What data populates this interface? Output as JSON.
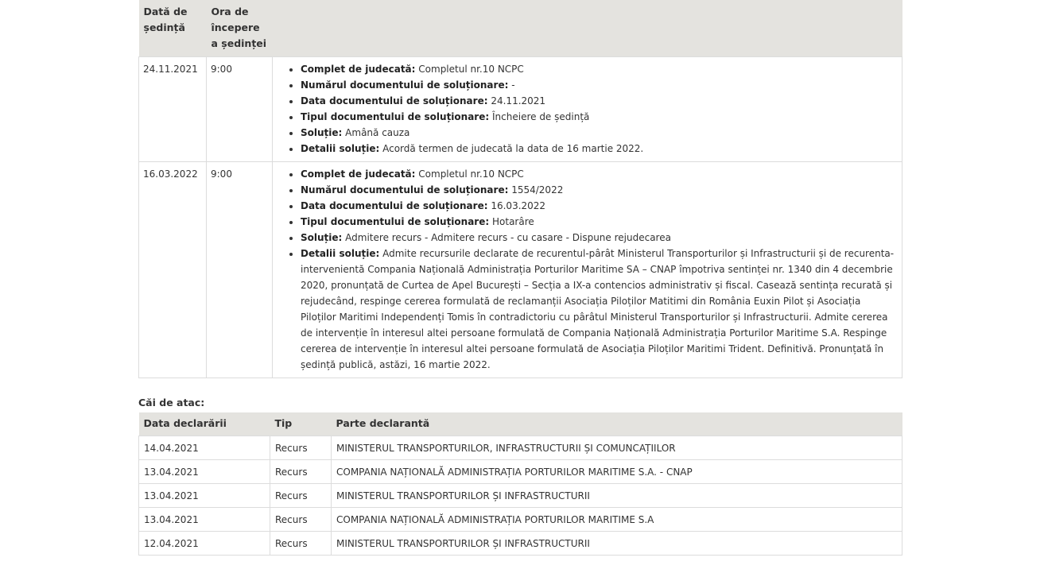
{
  "sessions": {
    "headers": {
      "date": "Dată de ședință",
      "time": "Ora de începere a ședinței",
      "details": ""
    },
    "rows": [
      {
        "date": "24.11.2021",
        "time": "9:00",
        "items": [
          {
            "label": "Complet de judecată:",
            "value": "Completul nr.10 NCPC"
          },
          {
            "label": "Numărul documentului de soluționare:",
            "value": "-"
          },
          {
            "label": "Data documentului de soluționare:",
            "value": "24.11.2021"
          },
          {
            "label": "Tipul documentului de soluționare:",
            "value": "Încheiere de ședință"
          },
          {
            "label": "Soluție:",
            "value": "Amână cauza"
          },
          {
            "label": "Detalii soluție:",
            "value": "Acordă termen de judecată la data de 16 martie 2022."
          }
        ]
      },
      {
        "date": "16.03.2022",
        "time": "9:00",
        "items": [
          {
            "label": "Complet de judecată:",
            "value": "Completul nr.10 NCPC"
          },
          {
            "label": "Numărul documentului de soluționare:",
            "value": "1554/2022"
          },
          {
            "label": "Data documentului de soluționare:",
            "value": "16.03.2022"
          },
          {
            "label": "Tipul documentului de soluționare:",
            "value": "Hotarâre"
          },
          {
            "label": "Soluție:",
            "value": "Admitere recurs - Admitere recurs - cu casare - Dispune rejudecarea"
          },
          {
            "label": "Detalii soluție:",
            "value": "Admite recursurile declarate de recurentul-pârât Ministerul Transporturilor și Infrastructurii și de recurenta-intervenientă Compania Națională Administrația Porturilor Maritime SA – CNAP împotriva sentinței nr. 1340 din 4 decembrie 2020, pronunțată de Curtea de Apel București – Secția a IX-a contencios administrativ și fiscal. Casează sentința recurată și rejudecând, respinge cererea formulată de reclamanții Asociația Piloților Matitimi din România Euxin Pilot și Asociația Piloților Maritimi Independenți Tomis în contradictoriu cu pârâtul Ministerul Transporturilor și Infrastructurii. Admite cererea de intervenție în interesul altei persoane formulată de Compania Națională Administrația Porturilor Maritime S.A. Respinge cererea de intervenție în interesul altei persoane formulată de Asociația Piloților Maritimi Trident. Definitivă. Pronunțată în ședință publică, astăzi, 16 martie 2022."
          }
        ]
      }
    ]
  },
  "cai_de_atac": {
    "title": "Căi de atac:",
    "headers": {
      "date": "Data declarării",
      "type": "Tip",
      "party": "Parte declarantă"
    },
    "rows": [
      {
        "date": "14.04.2021",
        "type": "Recurs",
        "party": "MINISTERUL TRANSPORTURILOR, INFRASTRUCTURII ȘI COMUNCAȚIILOR"
      },
      {
        "date": "13.04.2021",
        "type": "Recurs",
        "party": "COMPANIA NAȚIONALĂ ADMINISTRAȚIA PORTURILOR MARITIME S.A. - CNAP"
      },
      {
        "date": "13.04.2021",
        "type": "Recurs",
        "party": "MINISTERUL TRANSPORTURILOR ȘI INFRASTRUCTURII"
      },
      {
        "date": "13.04.2021",
        "type": "Recurs",
        "party": "COMPANIA NAȚIONALĂ ADMINISTRAȚIA PORTURILOR MARITIME S.A"
      },
      {
        "date": "12.04.2021",
        "type": "Recurs",
        "party": "MINISTERUL TRANSPORTURILOR ȘI INFRASTRUCTURII"
      }
    ]
  }
}
